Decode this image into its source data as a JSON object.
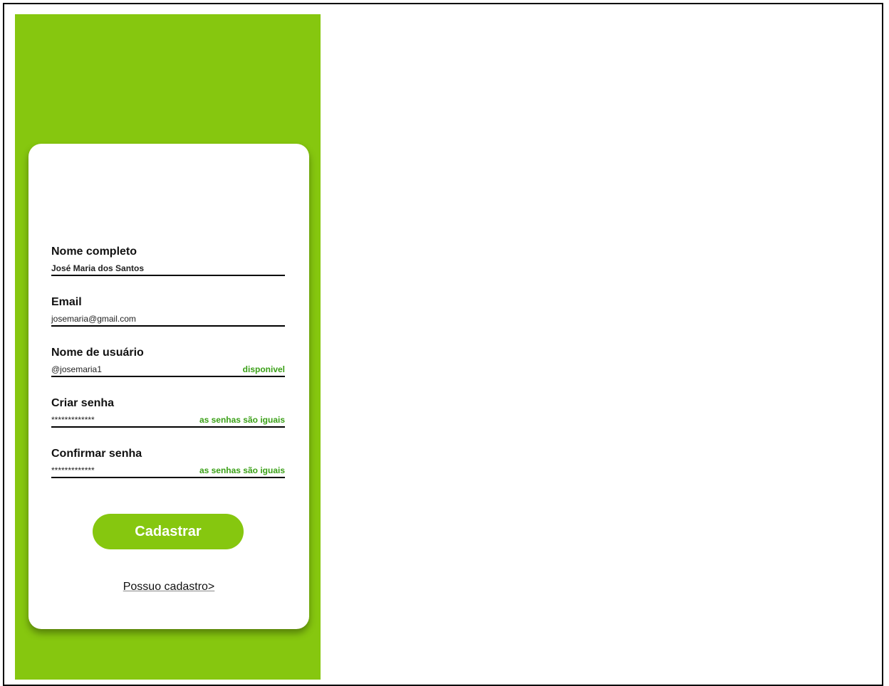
{
  "form": {
    "fields": [
      {
        "label": "Nome completo",
        "value": "José Maria dos Santos",
        "hint": ""
      },
      {
        "label": "Email",
        "value": "josemaria@gmail.com",
        "hint": ""
      },
      {
        "label": "Nome de usuário",
        "value": "@josemaria1",
        "hint": "disponivel"
      },
      {
        "label": "Criar senha",
        "value": "*************",
        "hint": "as senhas são iguais"
      },
      {
        "label": "Confirmar senha",
        "value": "*************",
        "hint": "as senhas são iguais"
      }
    ],
    "submit_label": "Cadastrar",
    "login_link": "Possuo cadastro>"
  },
  "colors": {
    "brand": "#86c70f",
    "hint": "#3aa017"
  }
}
